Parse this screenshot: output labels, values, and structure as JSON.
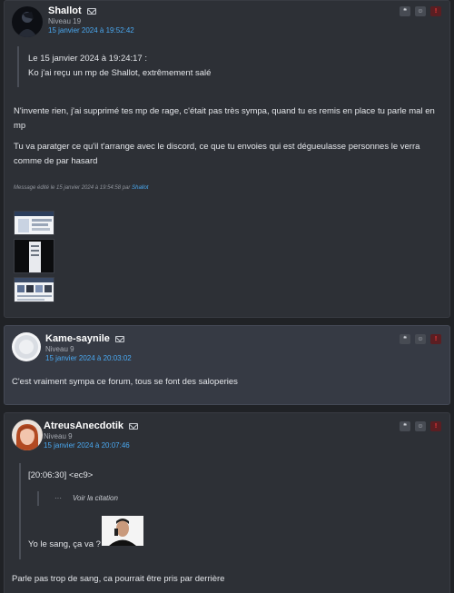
{
  "posts": [
    {
      "username": "Shallot",
      "level": "Niveau 19",
      "date": "15 janvier 2024 à 19:52:42",
      "quote_header": "Le 15 janvier 2024 à 19:24:17 :",
      "quote_text": "Ko j'ai reçu un mp de Shallot, extrêmement salé",
      "paragraph1": "N'invente rien, j'ai supprimé tes mp de rage, c'était pas très sympa, quand tu es remis en place tu parle mal en mp",
      "paragraph2": "Tu va paratger ce qu'il t'arrange avec le discord, ce que tu envoies qui est dégueulasse personnes le verra comme de par hasard",
      "edited_prefix": "Message édité le 15 janvier 2024 à 19:54:58 par",
      "edited_by": "Shallot"
    },
    {
      "username": "Kame-saynile",
      "level": "Niveau 9",
      "date": "15 janvier 2024 à 20:03:02",
      "body": "C'est vraiment sympa ce forum, tous se font des saloperies"
    },
    {
      "username": "AtreusAnecdotik",
      "level": "Niveau 9",
      "date": "15 janvier 2024 à 20:07:46",
      "quote_header": "[20:06:30] <ec9>",
      "view_quote_dots": "···",
      "view_quote": "Voir la citation",
      "quote_body": "Yo le sang, ça va ?",
      "body": "Parle pas trop de sang, ca pourrait être pris par derrière"
    }
  ],
  "action_buttons": {
    "quote": "❝",
    "mp": "☺",
    "alert": "!"
  },
  "colors": {
    "background": "#202226",
    "post_background": "#2d3036",
    "highlight_background": "#363a44",
    "link": "#4aa8f0",
    "alert": "#ff3a3a"
  }
}
